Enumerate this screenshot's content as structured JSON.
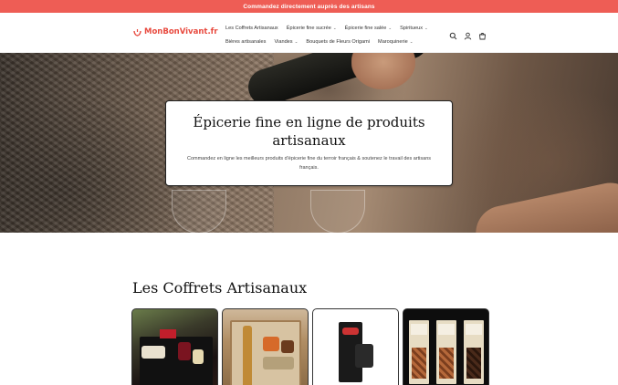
{
  "announcement": {
    "text": "Commandez directement auprès des artisans"
  },
  "header": {
    "logo_text": "MonBonVivant.fr",
    "nav_row1": [
      {
        "label": "Les Coffrets Artisanaux",
        "dropdown": false
      },
      {
        "label": "Épicerie fine sucrée",
        "dropdown": true
      },
      {
        "label": "Épicerie fine salée",
        "dropdown": true
      },
      {
        "label": "Spiritueux",
        "dropdown": true
      }
    ],
    "nav_row2": [
      {
        "label": "Bières artisanales",
        "dropdown": false
      },
      {
        "label": "Viandes",
        "dropdown": true
      },
      {
        "label": "Bouquets de Fleurs Origami",
        "dropdown": false
      },
      {
        "label": "Maroquinerie",
        "dropdown": true
      }
    ],
    "icons": [
      "search-icon",
      "account-icon",
      "cart-icon"
    ]
  },
  "hero": {
    "title": "Épicerie fine en ligne de produits artisanaux",
    "subtitle": "Commandez en ligne les meilleurs produits d'épicerie fine du terroir français & soutenez le travail des artisans français."
  },
  "collection": {
    "title": "Les Coffrets Artisanaux"
  },
  "colors": {
    "accent": "#ee5d55",
    "logo": "#e84a3f"
  }
}
